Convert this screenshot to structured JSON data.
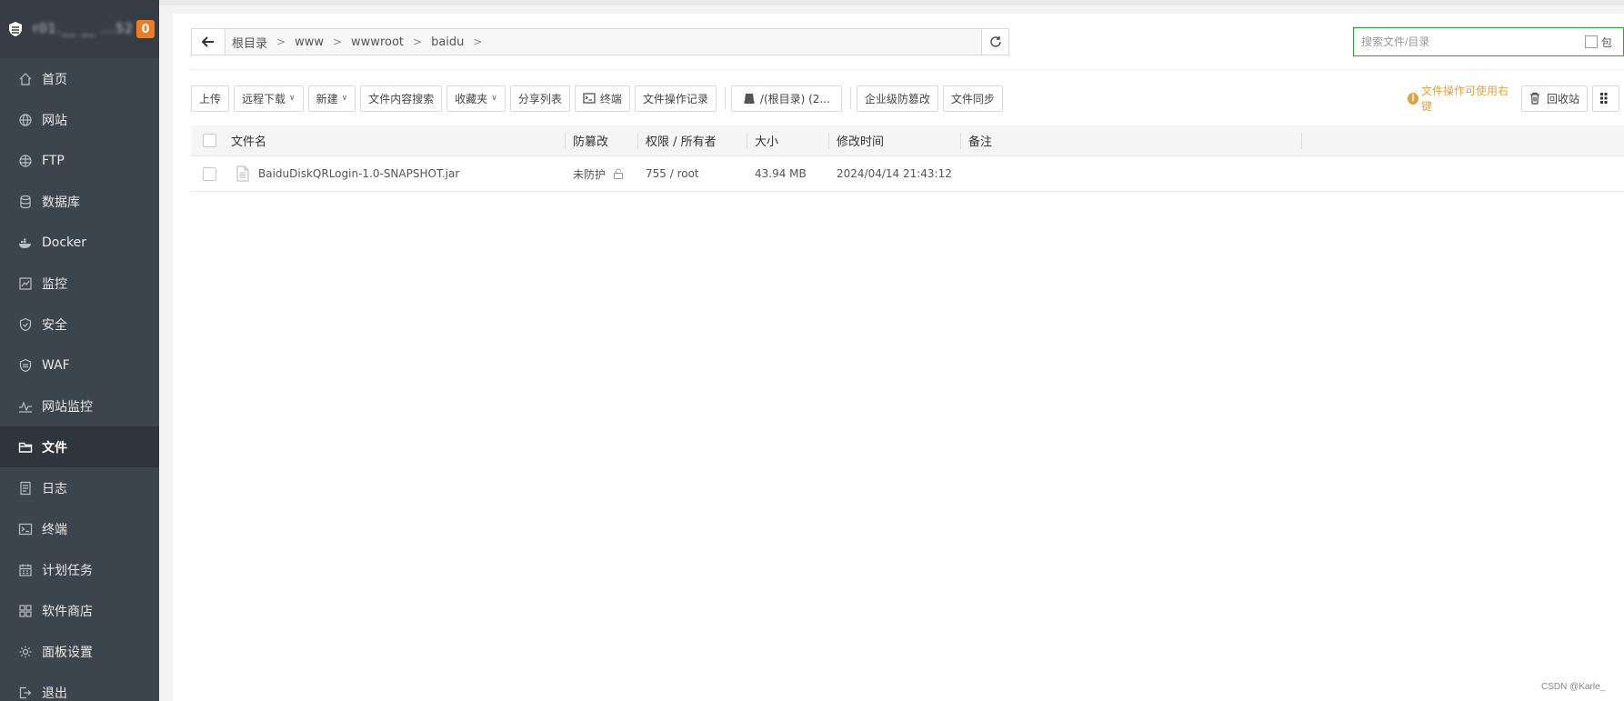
{
  "sidebar": {
    "server_name": "r01.__ __ ...52",
    "badge": "0",
    "items": [
      {
        "label": "首页",
        "icon": "home-icon"
      },
      {
        "label": "网站",
        "icon": "globe-icon"
      },
      {
        "label": "FTP",
        "icon": "ftp-globe-icon"
      },
      {
        "label": "数据库",
        "icon": "database-icon"
      },
      {
        "label": "Docker",
        "icon": "docker-icon"
      },
      {
        "label": "监控",
        "icon": "monitor-chart-icon"
      },
      {
        "label": "安全",
        "icon": "shield-check-icon"
      },
      {
        "label": "WAF",
        "icon": "waf-shield-icon"
      },
      {
        "label": "网站监控",
        "icon": "pulse-icon"
      },
      {
        "label": "文件",
        "icon": "folder-icon",
        "active": true
      },
      {
        "label": "日志",
        "icon": "log-icon"
      },
      {
        "label": "终端",
        "icon": "terminal-icon"
      },
      {
        "label": "计划任务",
        "icon": "calendar-icon"
      },
      {
        "label": "软件商店",
        "icon": "grid-apps-icon"
      },
      {
        "label": "面板设置",
        "icon": "gear-icon"
      },
      {
        "label": "退出",
        "icon": "logout-icon"
      }
    ]
  },
  "path": {
    "crumbs": [
      "根目录",
      "www",
      "wwwroot",
      "baidu"
    ]
  },
  "search": {
    "placeholder": "搜索文件/目录",
    "checkbox_label": "包"
  },
  "toolbar": {
    "upload": "上传",
    "remote_download": "远程下载",
    "new": "新建",
    "content_search": "文件内容搜索",
    "favorites": "收藏夹",
    "share_list": "分享列表",
    "terminal": "终端",
    "op_log": "文件操作记录",
    "disk": "/(根目录) (2...",
    "tamper": "企业级防篡改",
    "sync": "文件同步",
    "hint": "文件操作可使用右键",
    "recycle": "回收站"
  },
  "table": {
    "headers": {
      "name": "文件名",
      "tamper": "防篡改",
      "perm": "权限 / 所有者",
      "size": "大小",
      "mtime": "修改时间",
      "note": "备注"
    },
    "rows": [
      {
        "name": "BaiduDiskQRLogin-1.0-SNAPSHOT.jar",
        "tamper": "未防护",
        "perm": "755 / root",
        "size": "43.94 MB",
        "mtime": "2024/04/14 21:43:12",
        "note": ""
      }
    ]
  },
  "watermark": "CSDN @Karle_",
  "colors": {
    "sidebar_bg": "#3c444d",
    "active_bg": "#2f353c",
    "badge": "#f07c22",
    "accent_green": "#20a53a",
    "hint_orange": "#e6a23c"
  }
}
